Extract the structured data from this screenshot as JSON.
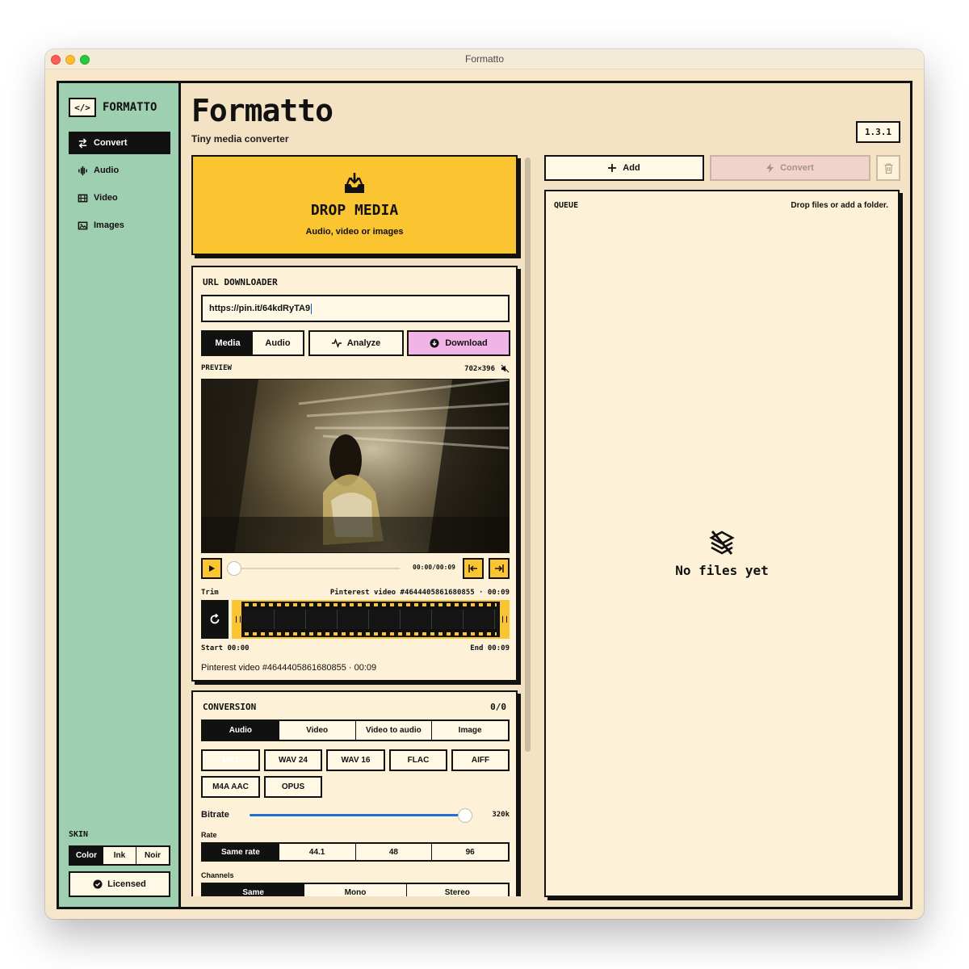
{
  "window": {
    "title": "Formatto"
  },
  "sidebar": {
    "logo_glyph": "</>",
    "logo_text": "FORMATTO",
    "items": [
      {
        "label": "Convert",
        "icon": "swap-icon",
        "active": true
      },
      {
        "label": "Audio",
        "icon": "waveform-icon",
        "active": false
      },
      {
        "label": "Video",
        "icon": "film-icon",
        "active": false
      },
      {
        "label": "Images",
        "icon": "image-icon",
        "active": false
      }
    ],
    "skin_label": "SKIN",
    "skin_options": [
      "Color",
      "Ink",
      "Noir"
    ],
    "skin_selected": "Color",
    "licensed_label": "Licensed"
  },
  "header": {
    "title": "Formatto",
    "subtitle": "Tiny media converter",
    "version": "1.3.1"
  },
  "drop": {
    "title": "DROP MEDIA",
    "subtitle": "Audio, video or images"
  },
  "url_downloader": {
    "heading": "URL DOWNLOADER",
    "url_value": "https://pin.it/64kdRyTA9",
    "mode_options": [
      "Media",
      "Audio"
    ],
    "mode_selected": "Media",
    "analyze_label": "Analyze",
    "download_label": "Download",
    "preview_label": "PREVIEW",
    "preview_size": "702×396",
    "time_display": "00:00/00:09",
    "trim_label": "Trim",
    "trim_title": "Pinterest video #4644405861680855 · 00:09",
    "start_label": "Start 00:00",
    "end_label": "End 00:09",
    "caption": "Pinterest video #4644405861680855 · 00:09"
  },
  "conversion": {
    "heading": "CONVERSION",
    "count": "0/0",
    "tabs": [
      "Audio",
      "Video",
      "Video to audio",
      "Image"
    ],
    "tab_selected": "Audio",
    "formats": [
      "MP3",
      "WAV 24",
      "WAV 16",
      "FLAC",
      "AIFF",
      "M4A AAC",
      "OPUS"
    ],
    "format_selected": "MP3",
    "bitrate_label": "Bitrate",
    "bitrate_value": "320k",
    "bitrate_level": 0.97,
    "rate_label": "Rate",
    "rate_options": [
      "Same rate",
      "44.1",
      "48",
      "96"
    ],
    "rate_selected": "Same rate",
    "channels_label": "Channels",
    "channel_options": [
      "Same",
      "Mono",
      "Stereo"
    ],
    "channel_selected": "Same"
  },
  "queue": {
    "add_label": "Add",
    "convert_label": "Convert",
    "heading": "QUEUE",
    "hint": "Drop files or add a folder.",
    "empty_text": "No files yet"
  },
  "colors": {
    "sidebar": "#9fcfb1",
    "accent_yellow": "#fbc431",
    "download_pink": "#f2b4e6",
    "bitrate_blue": "#1e6fd6",
    "panel": "#fdf2d8"
  }
}
